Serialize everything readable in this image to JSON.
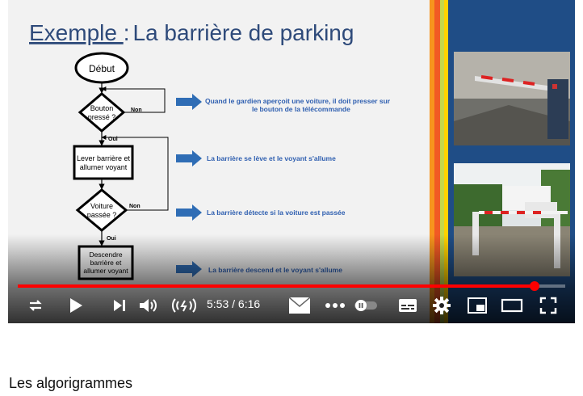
{
  "slide": {
    "title_prefix": "Exemple ",
    "title_colon": ":",
    "title_rest": "La barrière de parking",
    "flowchart": {
      "start": "Début",
      "decision1": [
        "Bouton",
        "pressé ?"
      ],
      "decision1_no": "Non",
      "decision1_yes": "Oui",
      "action1": [
        "Lever barrière et",
        "allumer voyant"
      ],
      "decision2": [
        "Voiture",
        "passée ?"
      ],
      "decision2_no": "Non",
      "decision2_yes": "Oui",
      "action2": [
        "Descendre",
        "barrière et",
        "allumer voyant"
      ]
    },
    "explanations": [
      [
        "Quand le gardien aperçoit une voiture, il doit presser sur",
        "le bouton de la télécommande"
      ],
      [
        "La barrière se lève et le voyant s'allume"
      ],
      [
        "La barrière détecte si la voiture est passée"
      ],
      [
        "La barrière descend et le voyant s'allume"
      ]
    ],
    "colors": {
      "title": "#2e4a7a",
      "arrow": "#2f6db5",
      "explanation": "#2f5fb0",
      "side_panel": "#1f4d86",
      "stripes": [
        "#f7941d",
        "#f15a24",
        "#c6d84a",
        "#ffd200"
      ]
    }
  },
  "player": {
    "progress_fraction": 0.944,
    "time_current": "5:53",
    "time_separator": " / ",
    "time_total": "6:16",
    "icons": [
      "loop-icon",
      "play-icon",
      "next-icon",
      "volume-icon",
      "stable-volume-icon",
      "mail-icon",
      "more-icon",
      "autoplay-toggle-icon",
      "subtitles-icon",
      "settings-icon",
      "miniplayer-icon",
      "theater-icon",
      "fullscreen-icon"
    ]
  },
  "video_title": "Les algorigrammes"
}
